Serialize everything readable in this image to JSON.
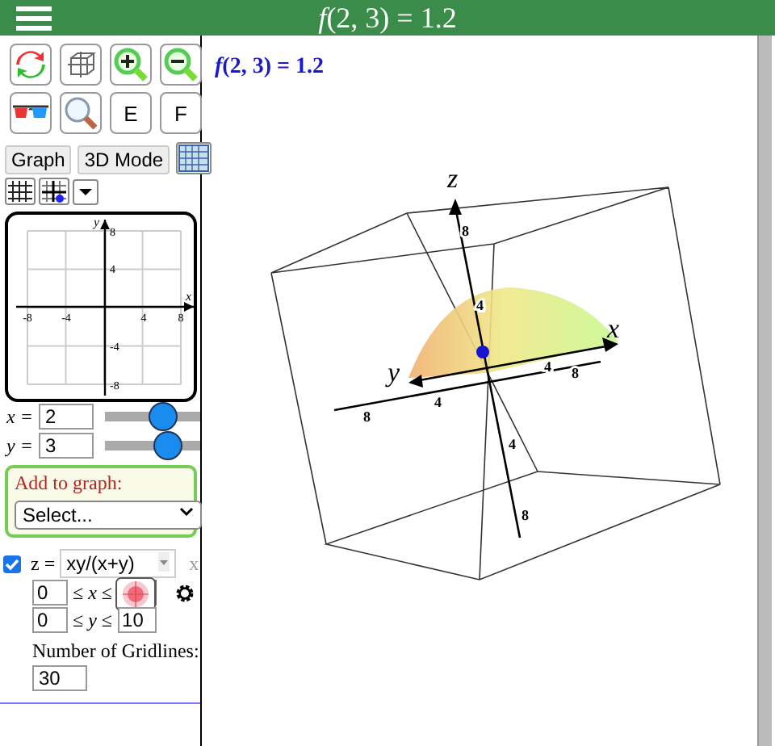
{
  "header": {
    "title": "*f*(2, 3) = 1.2"
  },
  "tools": {
    "letter_buttons": [
      "E",
      "F"
    ]
  },
  "modes": [
    {
      "label": "Graph"
    },
    {
      "label": "3D Mode"
    }
  ],
  "mini_graph": {
    "x_axis_label": "x",
    "y_axis_label": "y",
    "x_ticks": [
      "-8",
      "-4",
      "4",
      "8"
    ],
    "y_ticks": [
      "8",
      "4",
      "-4",
      "-8"
    ]
  },
  "point": [
    {
      "label": "x =",
      "value": "2",
      "level": 0.6
    },
    {
      "label": "y =",
      "value": "3",
      "level": 0.64
    }
  ],
  "add_to_graph": {
    "label": "Add to graph:",
    "select": "Select..."
  },
  "functions": [
    {
      "checked": true,
      "label": "z =",
      "expression": "xy/(x+y)",
      "remove": "x",
      "ranges": [
        {
          "min": "0",
          "relation": "≤ *x* ≤"
        },
        {
          "min": "0",
          "relation": "≤ *y* ≤",
          "max": "10"
        }
      ]
    }
  ],
  "gridlines": {
    "label": "Number of Gridlines:",
    "value": "30"
  },
  "plot": {
    "readout": "*f*(2, 3) = 1.2",
    "axis_labels": {
      "x": "x",
      "y": "y",
      "z": "z"
    },
    "z_ticks": [
      "8",
      "4",
      "4",
      "8"
    ],
    "x_ticks": [
      "4",
      "8"
    ],
    "y_ticks": [
      "4",
      "8"
    ]
  }
}
